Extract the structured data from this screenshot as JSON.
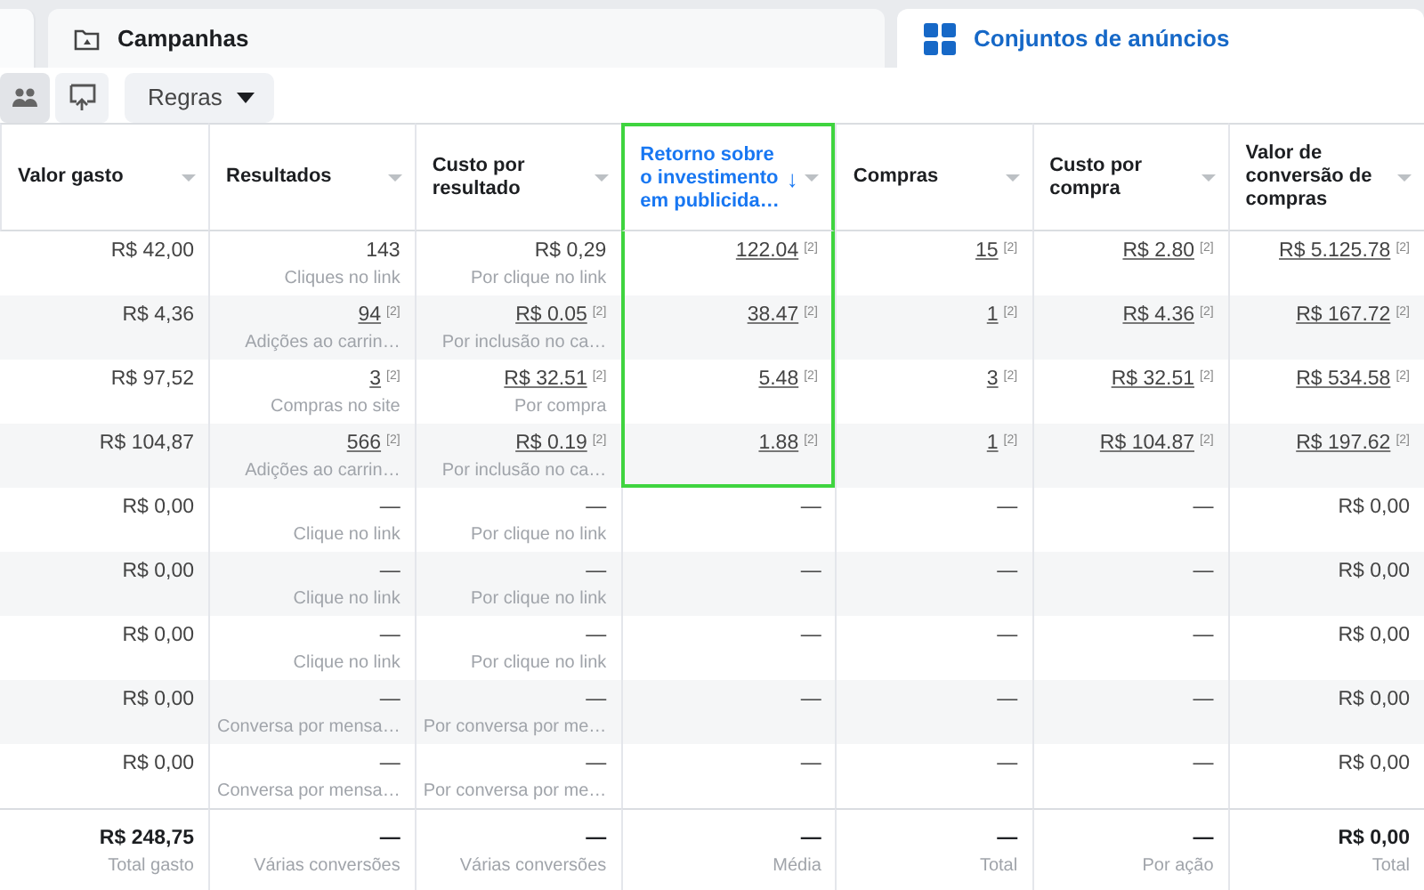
{
  "tabs": [
    {
      "label": "Campanhas",
      "kind": "folder",
      "selected": false
    },
    {
      "label": "Conjuntos de anúncios",
      "kind": "grid",
      "selected": true
    }
  ],
  "toolbar": {
    "buttons": [
      {
        "kind": "people",
        "pressed": true
      },
      {
        "kind": "share",
        "pressed": false
      }
    ],
    "rules_menu": {
      "label": "Regras"
    }
  },
  "table": {
    "columns": [
      {
        "label": "Valor gasto",
        "sorted": false,
        "highlighted": false
      },
      {
        "label": "Resultados",
        "sorted": false,
        "highlighted": false
      },
      {
        "label": "Custo por\nresultado",
        "sorted": false,
        "highlighted": false
      },
      {
        "label": "Retorno sobre\no investimento\nem publicida…",
        "sorted": true,
        "sort_arrow": "↓",
        "highlighted": true
      },
      {
        "label": "Compras",
        "sorted": false,
        "highlighted": false
      },
      {
        "label": "Custo por\ncompra",
        "sorted": false,
        "highlighted": false
      },
      {
        "label": "Valor de\nconversão de\ncompras",
        "sorted": false,
        "highlighted": false
      }
    ],
    "rows": [
      {
        "kind": "data",
        "cells": [
          {
            "value": "R$ 42,00"
          },
          {
            "value": "143",
            "caption": "Cliques no link"
          },
          {
            "value": "R$ 0,29",
            "caption": "Por clique no link"
          },
          {
            "value": "122.04",
            "footnote": "[2]",
            "highlighted": true
          },
          {
            "value": "15",
            "footnote": "[2]"
          },
          {
            "value": "R$ 2.80",
            "footnote": "[2]"
          },
          {
            "value": "R$ 5.125.78",
            "footnote": "[2]"
          }
        ]
      },
      {
        "kind": "data",
        "cells": [
          {
            "value": "R$ 4,36"
          },
          {
            "value": "94",
            "footnote": "[2]",
            "caption": "Adições ao carrin…"
          },
          {
            "value": "R$ 0.05",
            "footnote": "[2]",
            "caption": "Por inclusão no ca…"
          },
          {
            "value": "38.47",
            "footnote": "[2]",
            "highlighted": true
          },
          {
            "value": "1",
            "footnote": "[2]"
          },
          {
            "value": "R$ 4.36",
            "footnote": "[2]"
          },
          {
            "value": "R$ 167.72",
            "footnote": "[2]"
          }
        ]
      },
      {
        "kind": "data",
        "cells": [
          {
            "value": "R$ 97,52"
          },
          {
            "value": "3",
            "footnote": "[2]",
            "caption": "Compras no site"
          },
          {
            "value": "R$ 32.51",
            "footnote": "[2]",
            "caption": "Por compra"
          },
          {
            "value": "5.48",
            "footnote": "[2]",
            "highlighted": true
          },
          {
            "value": "3",
            "footnote": "[2]"
          },
          {
            "value": "R$ 32.51",
            "footnote": "[2]"
          },
          {
            "value": "R$ 534.58",
            "footnote": "[2]"
          }
        ]
      },
      {
        "kind": "data",
        "cells": [
          {
            "value": "R$ 104,87"
          },
          {
            "value": "566",
            "footnote": "[2]",
            "caption": "Adições ao carrin…"
          },
          {
            "value": "R$ 0.19",
            "footnote": "[2]",
            "caption": "Por inclusão no ca…"
          },
          {
            "value": "1.88",
            "footnote": "[2]",
            "highlighted": true
          },
          {
            "value": "1",
            "footnote": "[2]"
          },
          {
            "value": "R$ 104.87",
            "footnote": "[2]"
          },
          {
            "value": "R$ 197.62",
            "footnote": "[2]"
          }
        ]
      },
      {
        "kind": "data",
        "cells": [
          {
            "value": "R$ 0,00"
          },
          {
            "value": "—",
            "caption": "Clique no link"
          },
          {
            "value": "—",
            "caption": "Por clique no link"
          },
          {
            "value": "—"
          },
          {
            "value": "—"
          },
          {
            "value": "—"
          },
          {
            "value": "R$ 0,00"
          }
        ]
      },
      {
        "kind": "data",
        "cells": [
          {
            "value": "R$ 0,00"
          },
          {
            "value": "—",
            "caption": "Clique no link"
          },
          {
            "value": "—",
            "caption": "Por clique no link"
          },
          {
            "value": "—"
          },
          {
            "value": "—"
          },
          {
            "value": "—"
          },
          {
            "value": "R$ 0,00"
          }
        ]
      },
      {
        "kind": "data",
        "cells": [
          {
            "value": "R$ 0,00"
          },
          {
            "value": "—",
            "caption": "Clique no link"
          },
          {
            "value": "—",
            "caption": "Por clique no link"
          },
          {
            "value": "—"
          },
          {
            "value": "—"
          },
          {
            "value": "—"
          },
          {
            "value": "R$ 0,00"
          }
        ]
      },
      {
        "kind": "data",
        "cells": [
          {
            "value": "R$ 0,00"
          },
          {
            "value": "—",
            "caption": "Conversa por mensa…"
          },
          {
            "value": "—",
            "caption": "Por conversa por me…"
          },
          {
            "value": "—"
          },
          {
            "value": "—"
          },
          {
            "value": "—"
          },
          {
            "value": "R$ 0,00"
          }
        ]
      },
      {
        "kind": "data",
        "cells": [
          {
            "value": "R$ 0,00"
          },
          {
            "value": "—",
            "caption": "Conversa por mensa…"
          },
          {
            "value": "—",
            "caption": "Por conversa por me…"
          },
          {
            "value": "—"
          },
          {
            "value": "—"
          },
          {
            "value": "—"
          },
          {
            "value": "R$ 0,00"
          }
        ]
      },
      {
        "kind": "total",
        "cells": [
          {
            "value": "R$ 248,75",
            "caption": "Total gasto"
          },
          {
            "value": "—",
            "caption": "Várias conversões"
          },
          {
            "value": "—",
            "caption": "Várias conversões"
          },
          {
            "value": "—",
            "caption": "Média"
          },
          {
            "value": "—",
            "caption": "Total"
          },
          {
            "value": "—",
            "caption": "Por ação"
          },
          {
            "value": "R$ 0,00",
            "caption": "Total"
          }
        ]
      }
    ]
  }
}
